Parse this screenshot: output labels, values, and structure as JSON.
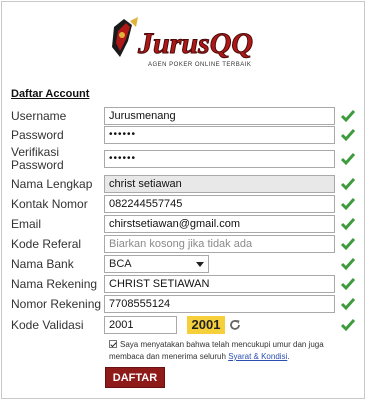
{
  "brand": {
    "logo_text": "JurusQQ",
    "logo_tagline": "AGEN POKER ONLINE TERBAIK"
  },
  "form": {
    "title": "Daftar Account",
    "fields": {
      "username": {
        "label": "Username",
        "value": "Jurusmenang"
      },
      "password": {
        "label": "Password",
        "value": "••••••"
      },
      "verify_password": {
        "label": "Verifikasi Password",
        "value": "••••••"
      },
      "full_name": {
        "label": "Nama Lengkap",
        "value": "christ setiawan"
      },
      "phone": {
        "label": "Kontak Nomor",
        "value": "082244557745"
      },
      "email": {
        "label": "Email",
        "value": "chirstsetiawan@gmail.com"
      },
      "referral": {
        "label": "Kode Referal",
        "placeholder": "Biarkan kosong jika tidak ada"
      },
      "bank": {
        "label": "Nama Bank",
        "value": "BCA"
      },
      "account_name": {
        "label": "Nama Rekening",
        "value": "CHRIST SETIAWAN"
      },
      "account_number": {
        "label": "Nomor Rekening",
        "value": "7708555124"
      },
      "captcha": {
        "label": "Kode Validasi",
        "value": "2001",
        "image_text": "2001"
      }
    },
    "agreement": {
      "text": "Saya menyatakan bahwa telah mencukupi umur dan juga membaca dan menerima seluruh",
      "link": "Syarat & Kondisi",
      "suffix": "."
    },
    "submit_label": "DAFTAR"
  },
  "colors": {
    "check": "#3f9b3f",
    "button": "#8f1a1a",
    "captcha_bg": "#f6d03a",
    "logo_red": "#b01818"
  },
  "icons": {
    "valid": "check-icon",
    "refresh": "refresh-icon"
  }
}
